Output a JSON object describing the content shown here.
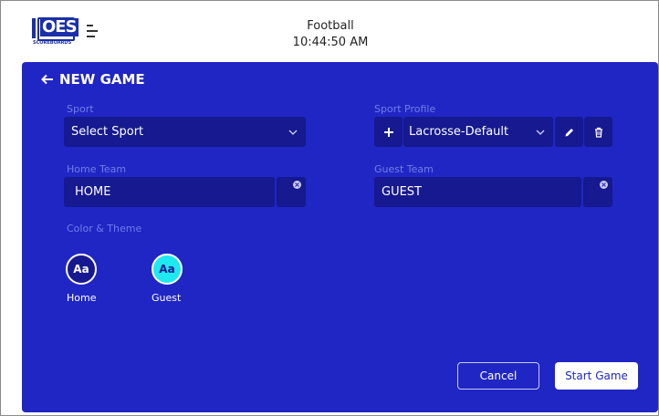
{
  "header": {
    "logo_text": "OES",
    "logo_subtext": "SCOREBOARDS",
    "title": "Football",
    "time": "10:44:50 AM"
  },
  "page": {
    "back_label": "NEW GAME"
  },
  "form": {
    "sport": {
      "label": "Sport",
      "value": "Select Sport"
    },
    "sport_profile": {
      "label": "Sport Profile",
      "value": "Lacrosse-Default"
    },
    "home_team": {
      "label": "Home Team",
      "value": "HOME"
    },
    "guest_team": {
      "label": "Guest Team",
      "value": "GUEST"
    },
    "color_theme": {
      "label": "Color & Theme",
      "home": {
        "badge": "Aa",
        "label": "Home"
      },
      "guest": {
        "badge": "Aa",
        "label": "Guest"
      }
    }
  },
  "actions": {
    "cancel_label": "Cancel",
    "start_label": "Start Game"
  },
  "colors": {
    "panel": "#2026c4",
    "field": "#16198f",
    "label": "#6f7de6",
    "home_theme": "#16198f",
    "guest_theme": "#1ee8f0"
  }
}
